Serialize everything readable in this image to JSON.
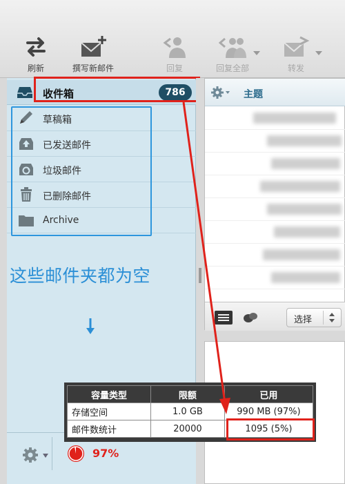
{
  "toolbar": {
    "refresh": "刷新",
    "compose": "撰写新邮件",
    "reply": "回复",
    "reply_all": "回复全部",
    "forward": "转发"
  },
  "folders": {
    "inbox": {
      "label": "收件箱",
      "count": "786"
    },
    "items": [
      {
        "label": "草稿箱",
        "icon": "pencil-icon"
      },
      {
        "label": "已发送邮件",
        "icon": "outbox-icon"
      },
      {
        "label": "垃圾邮件",
        "icon": "recycle-icon"
      },
      {
        "label": "已删除邮件",
        "icon": "trash-icon"
      },
      {
        "label": "Archive",
        "icon": "folder-icon"
      }
    ]
  },
  "annotation": "这些邮件夹都为空",
  "message_list": {
    "subject_header": "主题",
    "select_label": "选择"
  },
  "quota": {
    "percent": "97%"
  },
  "stats_table": {
    "headers": [
      "容量类型",
      "限额",
      "已用"
    ],
    "rows": [
      [
        "存储空间",
        "1.0 GB",
        "990 MB (97%)"
      ],
      [
        "邮件数统计",
        "20000",
        "1095 (5%)"
      ]
    ]
  },
  "colors": {
    "accent_red": "#e0221b",
    "annotation_blue": "#2b8fd6",
    "badge_bg": "#1f4e64"
  }
}
